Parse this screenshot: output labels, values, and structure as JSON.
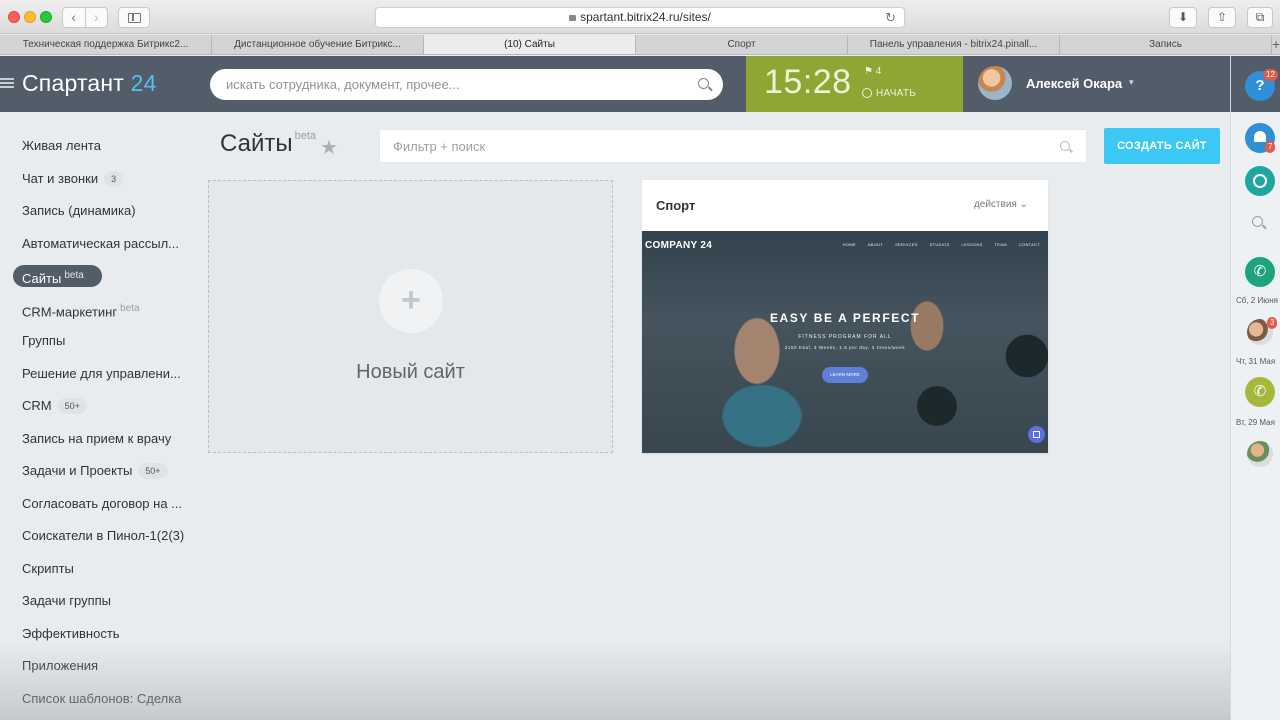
{
  "browser": {
    "url": "spartant.bitrix24.ru/sites/",
    "tabs": [
      {
        "label": "Техническая поддержка Битрикс2..."
      },
      {
        "label": "Дистанционное обучение Битрикс..."
      },
      {
        "label": "(10) Сайты"
      },
      {
        "label": "Спорт"
      },
      {
        "label": "Панель управления - bitrix24.pinall..."
      },
      {
        "label": "Запись"
      }
    ],
    "active_tab": 2,
    "new_tab_glyph": "+"
  },
  "header": {
    "logo_text": "Спартант",
    "logo_number": "24",
    "search_placeholder": "искать сотрудника, документ, прочее...",
    "clock_time": "15:28",
    "clock_flag_count": "4",
    "clock_start_label": "НАЧАТЬ",
    "user_name": "Алексей Окара",
    "user_caret": "▾"
  },
  "right_bar": {
    "help_label": "?",
    "help_badge": "12",
    "bell_badge": "7",
    "calls": [
      {
        "date": "Сб, 2 Июня",
        "color": "#1fa27e"
      },
      {
        "date": "Чт, 31 Мая",
        "color": "#e8a24a"
      },
      {
        "date": "Вт, 29 Мая",
        "color": "#a6b83a"
      }
    ],
    "avatar_badge": "3",
    "colors": {
      "bell": "#2f8fd7",
      "chat": "#1fa6a0"
    }
  },
  "menu": {
    "items": [
      {
        "label": "Живая лента"
      },
      {
        "label": "Чат и звонки",
        "count": "3"
      },
      {
        "label": "Запись (динамика)"
      },
      {
        "label": "Автоматическая рассыл..."
      },
      {
        "label": "Сайты",
        "sup": "beta",
        "active": true
      },
      {
        "label": "CRM-маркетинг",
        "sup": "beta"
      },
      {
        "label": "Группы"
      },
      {
        "label": "Решение для управлени..."
      },
      {
        "label": "CRM",
        "count": "50+"
      },
      {
        "label": "Запись на прием к врачу"
      },
      {
        "label": "Задачи и Проекты",
        "count": "50+"
      },
      {
        "label": "Согласовать договор на ..."
      },
      {
        "label": "Соискатели в Пинол-1(2(3)"
      },
      {
        "label": "Скрипты"
      },
      {
        "label": "Задачи группы"
      },
      {
        "label": "Эффективность"
      },
      {
        "label": "Приложения"
      },
      {
        "label": "Список шаблонов: Сделка"
      }
    ]
  },
  "content": {
    "title": "Сайты",
    "title_sup": "beta",
    "filter_placeholder": "Фильтр + поиск",
    "create_button": "СОЗДАТЬ САЙТ",
    "new_site_label": "Новый сайт",
    "new_site_plus": "+",
    "site_card": {
      "title": "Спорт",
      "actions_label": "действия",
      "preview": {
        "brand": "COMPANY 24",
        "nav": [
          "HOME",
          "ABOUT",
          "SERVICES",
          "STUDIOS",
          "LESSONS",
          "TEAM",
          "CONTACT"
        ],
        "headline": "EASY BE A PERFECT",
        "subheadline": "FITNESS PROGRAM FOR ALL",
        "stats": "2150 Kkal, 3 Weeks, 1,5 per day, 3 times/week",
        "button": "LEARN MORE"
      }
    }
  },
  "colors": {
    "header_bg": "#535c69",
    "clock_bg": "#8fa534",
    "accent_blue": "#3bc8f5",
    "logo_number": "#55c0f0"
  }
}
